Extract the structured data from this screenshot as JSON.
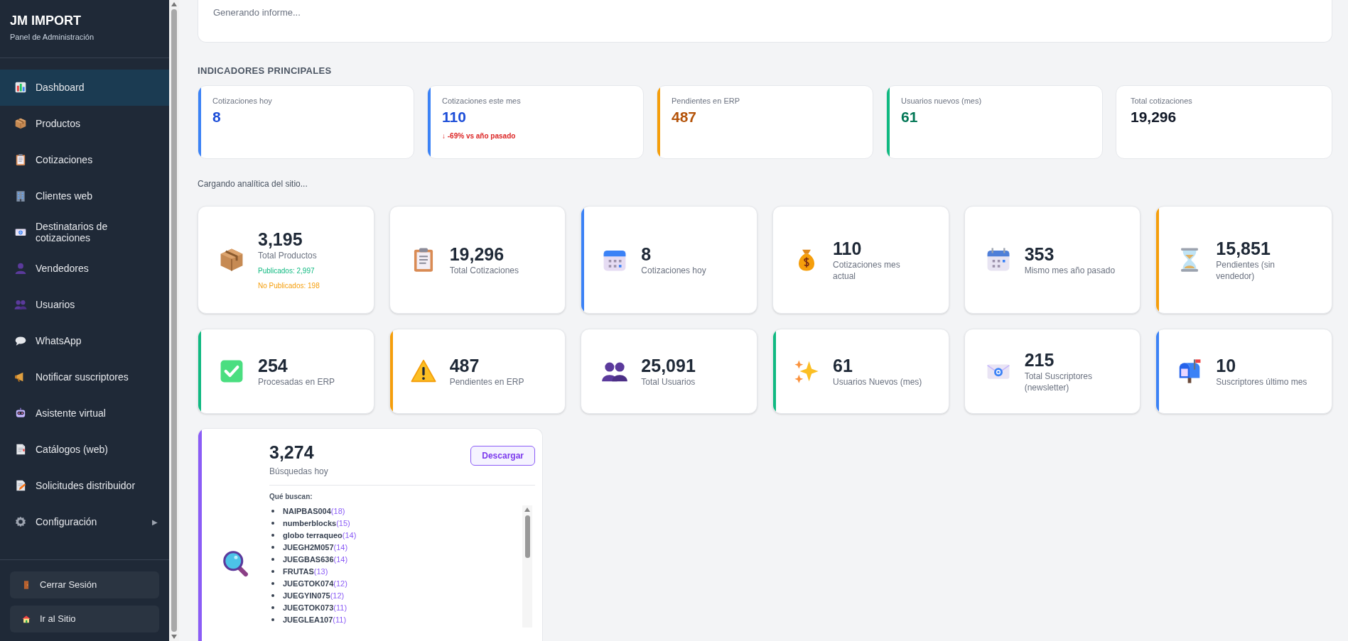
{
  "sidebar": {
    "title": "JM IMPORT",
    "subtitle": "Panel de Administración",
    "items": [
      {
        "label": "Dashboard",
        "selected": true
      },
      {
        "label": "Productos",
        "selected": false
      },
      {
        "label": "Cotizaciones",
        "selected": false
      },
      {
        "label": "Clientes web",
        "selected": false
      },
      {
        "label": "Destinatarios de cotizaciones",
        "selected": false
      },
      {
        "label": "Vendedores",
        "selected": false
      },
      {
        "label": "Usuarios",
        "selected": false
      },
      {
        "label": "WhatsApp",
        "selected": false
      },
      {
        "label": "Notificar suscriptores",
        "selected": false
      },
      {
        "label": "Asistente virtual",
        "selected": false
      },
      {
        "label": "Catálogos (web)",
        "selected": false
      },
      {
        "label": "Solicitudes distribuidor",
        "selected": false
      },
      {
        "label": "Configuración",
        "selected": false,
        "arrow": "▶"
      }
    ],
    "buttons": [
      "Cerrar Sesión",
      "Ir al Sitio"
    ]
  },
  "report": {
    "text": "Generando informe..."
  },
  "kpi_heading": "INDICADORES PRINCIPALES",
  "kpis": [
    {
      "label": "Cotizaciones hoy",
      "value": "8",
      "color": "#3b82f6"
    },
    {
      "label": "Cotizaciones este mes",
      "value": "110",
      "color": "#3b82f6",
      "note": "↓ -69% vs año pasado"
    },
    {
      "label": "Pendientes en ERP",
      "value": "487",
      "color": "#f59e0b"
    },
    {
      "label": "Usuarios nuevos (mes)",
      "value": "61",
      "color": "#10b981"
    },
    {
      "label": "Total cotizaciones",
      "value": "19,296"
    }
  ],
  "analytics_status": "Cargando analítica del sitio...",
  "stats": [
    {
      "value": "3,195",
      "label": "Total Productos",
      "sub": [
        {
          "text": "Publicados: 2,997",
          "color": "#10b981"
        },
        {
          "text": "No Publicados: 198",
          "color": "#f59e0b"
        }
      ]
    },
    {
      "value": "19,296",
      "label": "Total Cotizaciones"
    },
    {
      "value": "8",
      "label": "Cotizaciones hoy",
      "color": "#3b82f6"
    },
    {
      "value": "110",
      "label": "Cotizaciones mes actual"
    },
    {
      "value": "353",
      "label": "Mismo mes año pasado"
    },
    {
      "value": "15,851",
      "label": "Pendientes (sin vendedor)",
      "color": "#f59e0b"
    },
    {
      "value": "254",
      "label": "Procesadas en ERP",
      "color": "#10b981"
    },
    {
      "value": "487",
      "label": "Pendientes en ERP",
      "color": "#f59e0b"
    },
    {
      "value": "25,091",
      "label": "Total Usuarios"
    },
    {
      "value": "61",
      "label": "Usuarios Nuevos (mes)",
      "color": "#10b981"
    },
    {
      "value": "215",
      "label": "Total Suscriptores (newsletter)"
    },
    {
      "value": "10",
      "label": "Suscriptores último mes",
      "color": "#3b82f6"
    }
  ],
  "searches": {
    "value": "3,274",
    "label": "Búsquedas hoy",
    "button": "Descargar",
    "heading": "Qué buscan:",
    "color": "#8b5cf6",
    "terms": [
      {
        "term": "NAIPBAS004",
        "count": "(18)"
      },
      {
        "term": "numberblocks",
        "count": "(15)"
      },
      {
        "term": "globo terraqueo",
        "count": "(14)"
      },
      {
        "term": "JUEGH2M057",
        "count": "(14)"
      },
      {
        "term": "JUEGBAS636",
        "count": "(14)"
      },
      {
        "term": "FRUTAS",
        "count": "(13)"
      },
      {
        "term": "JUEGTOK074",
        "count": "(12)"
      },
      {
        "term": "JUEGYIN075",
        "count": "(12)"
      },
      {
        "term": "JUEGTOK073",
        "count": "(11)"
      },
      {
        "term": "JUEGLEA107",
        "count": "(11)"
      }
    ]
  }
}
